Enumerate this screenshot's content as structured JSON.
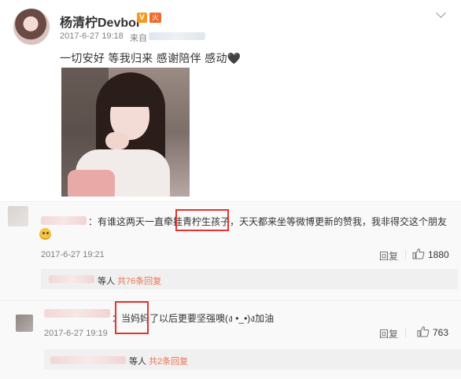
{
  "post": {
    "username": "杨清柠Devbor",
    "verify_badge": "V",
    "fire_badge": "火",
    "time": "2017-6-27 19:18",
    "from_label": "来自",
    "text": "一切安好 等我归来 感谢陪伴 感动🖤"
  },
  "comments": [
    {
      "separator": "：",
      "text_before": "有谁这两天一直牵挂",
      "highlight": "青柠生孩子",
      "text_after": "，天天都来坐等微博更新的赞我，我非得交这个朋友",
      "emoji": "sad-face-emoji",
      "time": "2017-6-27 19:21",
      "reply_label": "回复",
      "like_count": "1880",
      "sub_replies": {
        "prefix": "等人",
        "count_text": "共76条回复"
      }
    },
    {
      "separator": "：",
      "text_before": "",
      "highlight": "当妈妈",
      "text_after": "了以后更要坚强噢(ง •_•)ง加油",
      "time": "2017-6-27 19:19",
      "reply_label": "回复",
      "like_count": "763",
      "sub_replies": {
        "prefix": "等人",
        "count_text": "共2条回复"
      }
    }
  ],
  "colors": {
    "accent_orange": "#eb7350",
    "highlight_red": "#e3342f",
    "text_gray": "#808080"
  }
}
